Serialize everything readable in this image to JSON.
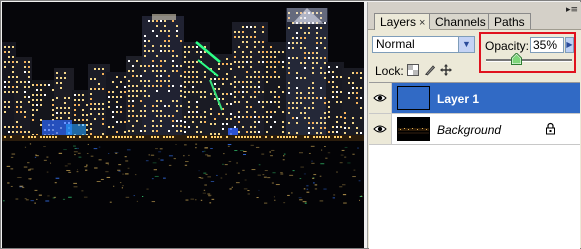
{
  "panel": {
    "tabs": [
      {
        "label": "Layers",
        "close": "×"
      },
      {
        "label": "Channels"
      },
      {
        "label": "Paths"
      }
    ],
    "menu_icon": "panel-menu-arrow-icon"
  },
  "controls": {
    "blend_mode": "Normal",
    "opacity_label": "Opacity:",
    "opacity_value": "35%",
    "opacity_fraction": 0.35,
    "lock_label": "Lock:"
  },
  "layers": [
    {
      "name": "Layer 1",
      "selected": true,
      "visible": true,
      "locked": false
    },
    {
      "name": "Background",
      "selected": false,
      "visible": true,
      "locked": true
    }
  ],
  "colors": {
    "highlight_box": "#e0121e",
    "selection": "#316ac5"
  }
}
